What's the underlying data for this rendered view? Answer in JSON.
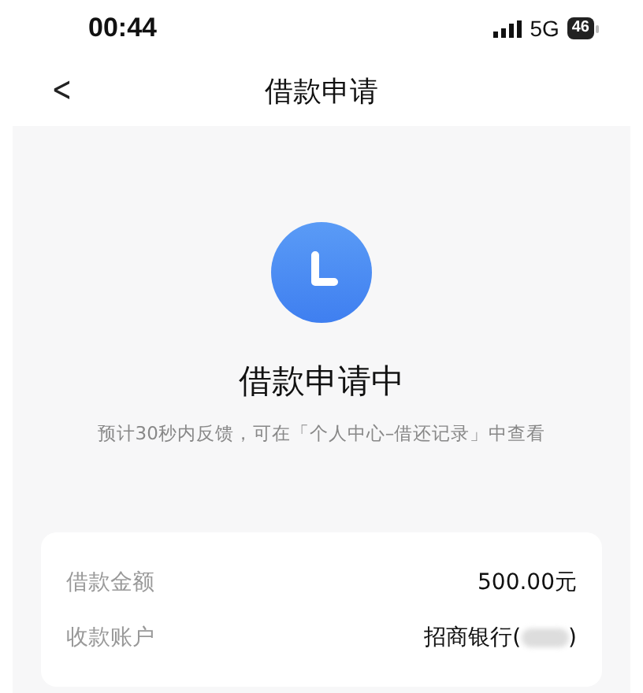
{
  "status_bar": {
    "time": "00:44",
    "network": "5G",
    "battery": "46"
  },
  "nav": {
    "back": "<",
    "title": "借款申请"
  },
  "result": {
    "title": "借款申请中",
    "note": "预计30秒内反馈，可在「个人中心–借还记录」中查看"
  },
  "details": [
    {
      "kind": "plain",
      "label": "借款金额",
      "value": "500.00元"
    },
    {
      "kind": "masked",
      "label": "收款账户",
      "value": "招商银行(",
      "suffix": ")"
    }
  ]
}
